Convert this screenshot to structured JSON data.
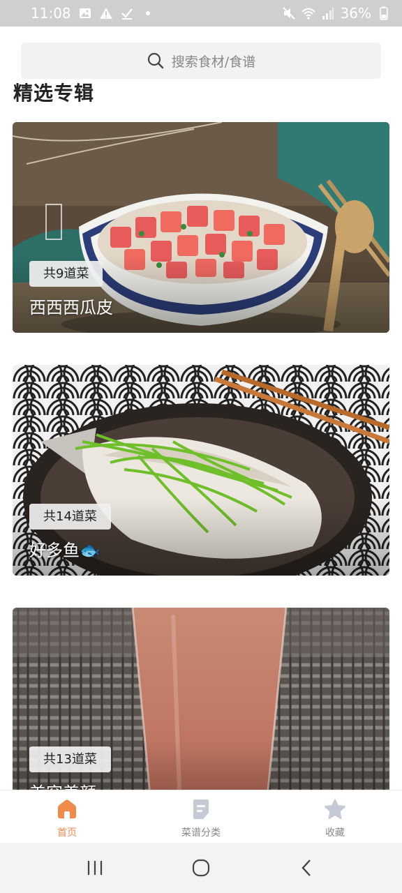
{
  "status_bar": {
    "time": "11:08",
    "battery": "36%",
    "icons": [
      "image-icon",
      "warning-icon",
      "download-done-icon",
      "dot-icon",
      "mute-icon",
      "wifi-icon",
      "signal-icon",
      "battery-icon"
    ]
  },
  "search": {
    "placeholder": "搜索食材/食谱",
    "icon": "search-icon"
  },
  "main": {
    "section_title": "精选专辑",
    "cards": [
      {
        "count": "共9道菜",
        "title": "西西西瓜皮"
      },
      {
        "count": "共14道菜",
        "title": "好多鱼🐟"
      },
      {
        "count": "共13道菜",
        "title": "美容养颜"
      }
    ]
  },
  "tabs": [
    {
      "label": "首页",
      "icon": "home-icon",
      "active": true
    },
    {
      "label": "菜谱分类",
      "icon": "recipe-category-icon",
      "active": false
    },
    {
      "label": "收藏",
      "icon": "star-icon",
      "active": false
    }
  ],
  "colors": {
    "accent": "#f08a4b",
    "tab_inactive": "#c5cad6",
    "status_bar_bg": "#cfcfcf"
  }
}
